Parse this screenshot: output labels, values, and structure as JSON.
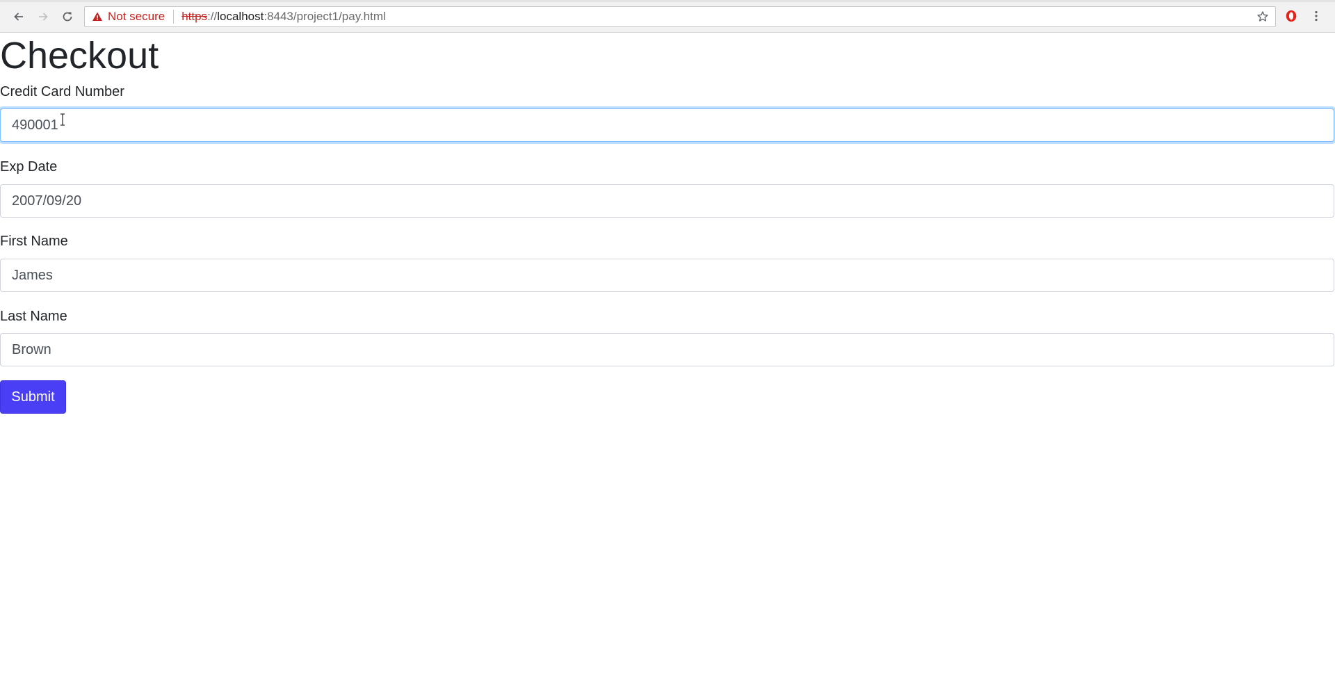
{
  "browser": {
    "security_label": "Not secure",
    "url": {
      "scheme": "https",
      "separator": "://",
      "host": "localhost",
      "rest": ":8443/project1/pay.html"
    },
    "icons": {
      "back": "arrow-left-icon",
      "forward": "arrow-right-icon",
      "reload": "reload-icon",
      "warning": "warning-triangle-icon",
      "bookmark": "star-icon",
      "extension": "opera-extension-icon",
      "menu": "kebab-menu-icon"
    }
  },
  "page": {
    "title": "Checkout",
    "fields": [
      {
        "label": "Credit Card Number",
        "value": "490001",
        "focused": true
      },
      {
        "label": "Exp Date",
        "value": "2007/09/20",
        "focused": false
      },
      {
        "label": "First Name",
        "value": "James",
        "focused": false
      },
      {
        "label": "Last Name",
        "value": "Brown",
        "focused": false
      }
    ],
    "submit_label": "Submit"
  },
  "colors": {
    "accent": "#4a3ff5",
    "warning": "#c5221f",
    "focus_border": "#80bdff"
  }
}
